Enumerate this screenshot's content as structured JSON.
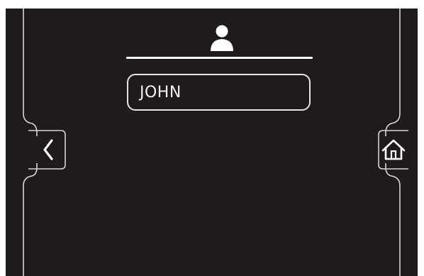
{
  "profile": {
    "name_value": "JOHN"
  },
  "icons": {
    "user": "user-icon",
    "back": "chevron-left-icon",
    "home": "home-icon"
  },
  "colors": {
    "background": "#1f1b1c",
    "foreground": "#ffffff",
    "outline": "#d9d4d2"
  }
}
